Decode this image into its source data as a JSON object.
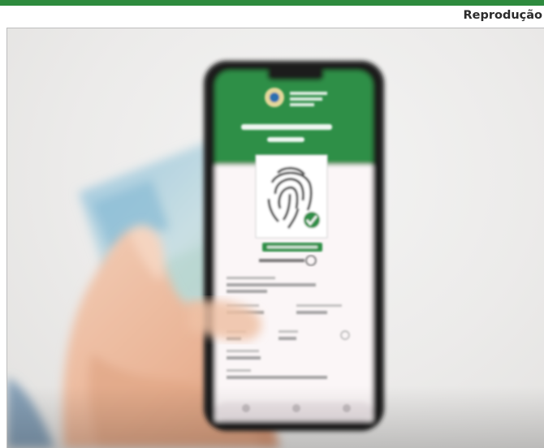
{
  "credit": "Reprodução",
  "colors": {
    "accent_bar": "#2e8b3e",
    "app_green": "#2f8f46",
    "background": "#ecebea"
  },
  "icons": {
    "fingerprint": "fingerprint-icon",
    "check": "check-circle-icon",
    "help": "question-circle-icon"
  }
}
